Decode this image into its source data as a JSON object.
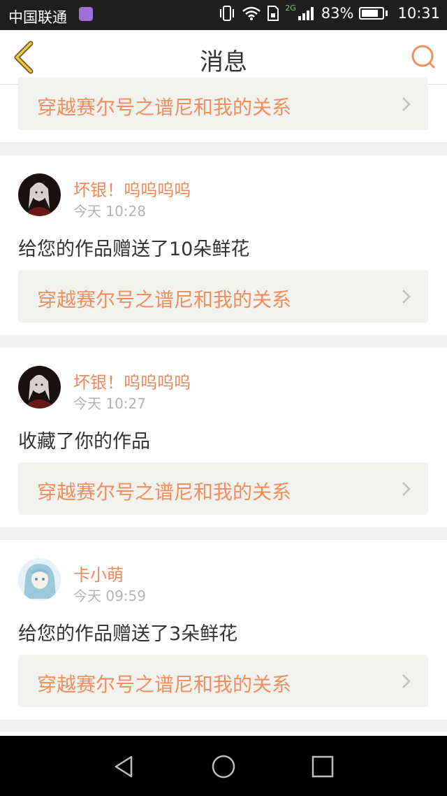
{
  "status_bar": {
    "carrier": "中国联通",
    "network": "2G",
    "battery": "83%",
    "battery_level": 0.83,
    "time": "10:31"
  },
  "header": {
    "title": "消息"
  },
  "colors": {
    "accent": "#f08e5e",
    "name_color": "#f0895a",
    "time_color": "#b3b3b3",
    "card_link_bg": "#f2f2ee"
  },
  "messages": [
    {
      "user": "",
      "time": "",
      "text": "",
      "work_title": "穿越赛尔号之谱尼和我的关系"
    },
    {
      "user": "坏银！呜呜呜呜",
      "time": "今天 10:28",
      "text": "给您的作品赠送了10朵鲜花",
      "work_title": "穿越赛尔号之谱尼和我的关系"
    },
    {
      "user": "坏银！呜呜呜呜",
      "time": "今天 10:27",
      "text": "收藏了你的作品",
      "work_title": "穿越赛尔号之谱尼和我的关系"
    },
    {
      "user": "卡小萌",
      "time": "今天 09:59",
      "text": "给您的作品赠送了3朵鲜花",
      "work_title": "穿越赛尔号之谱尼和我的关系"
    }
  ],
  "icons": {
    "back": "chevron-left-icon",
    "search": "search-icon",
    "link": "chevron-right-icon",
    "nav_back": "triangle-back-icon",
    "nav_home": "circle-home-icon",
    "nav_recent": "square-recent-icon"
  }
}
